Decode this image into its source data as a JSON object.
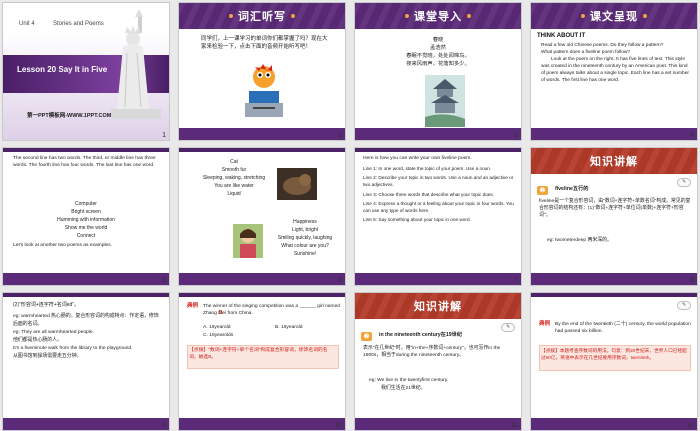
{
  "slides": [
    {
      "num": "1",
      "unit": "Unit 4",
      "unit_title": "Stories and Poems",
      "lesson": "Lesson 20  Say It in Five",
      "site": "第一PPT模板网-WWW.1PPT.COM"
    },
    {
      "num": "2",
      "title": "词汇听写",
      "body": "同学们，上一课学习的单词你们都掌握了吗？现在大家来检验一下，点击下面的音频开始听写吧！"
    },
    {
      "num": "3",
      "title": "课堂导入",
      "poem": [
        "春晓",
        "孟浩然",
        "春眠不觉晓，处处闻啼鸟。",
        "夜来风雨声，花落知多少。"
      ]
    },
    {
      "num": "4",
      "title": "课文呈现",
      "heading": "THINK ABOUT IT",
      "lines": [
        "Read a few old Chinese poems. Do they follow a pattern?",
        "What pattern does a fiveline poem follow?",
        "Look at the poem on the right. It has five lines of text. This style was created in the nineteenth century by an American poet. This kind of poem always talks about a single topic. Each line has a set number of words. The first line has one word."
      ]
    },
    {
      "num": "5",
      "lines": [
        "The second line has two words. The third, or middle line has three words. The fourth line has four words. The last line has one word."
      ],
      "poem": [
        "Computer",
        "Bright screen",
        "Humming with information",
        "Show me the world",
        "Connect"
      ],
      "ending": "Let's look at another two poems as examples."
    },
    {
      "num": "6",
      "poem1": [
        "Cat",
        "Smooth fur",
        "Sleeping, waking, stretching",
        "You are like water",
        "Liquid"
      ],
      "poem2": [
        "Happiness",
        "Light, bright",
        "Smiling quickly, laughing",
        "What colour are you?",
        "Sunshine!"
      ]
    },
    {
      "num": "7",
      "intro": "Here is how you can write your own fiveline poem.",
      "steps": [
        "Line 1:  In one word, state the topic of your poem. Use a noun.",
        "Line 2:  Describe your topic in two words. Use a noun and an adjective or two adjectives.",
        "Line 3:  Choose three words that describe what your topic does.",
        "Line 4:  Express a thought or a feeling about your topic in four words. You can use any type of words here.",
        "Line 5:  Say something about your topic in one word."
      ]
    },
    {
      "num": "8",
      "title": "知识讲解",
      "point": "fiveline五行的",
      "body": "fiveline是一个复合形容词，由\"数词+连字符+单数名词\"构成。常见的复合形容词的结构还有：(1)\"数词+连字符+单位词(单数)+连字符+形容词\"；",
      "eg": "eg: twometerdeep  两米深的。"
    },
    {
      "num": "9",
      "line0": "(2)\"形容词+连字符+名词ed\"。",
      "lines": [
        "eg: warmhearted 热心肠的。复合形容词的构成特点：作定语，修饰后面的名词。",
        "eg: They are all warmhearted people.",
        "他们都是热心肠的人。",
        "It's a fiveminute walk from the library to the playground.",
        "从图书馆到操场需要走五分钟。"
      ]
    },
    {
      "num": "10",
      "label": "典例",
      "q": "The winner of the singing competition was a ______ girl named Zhang Mei from China.",
      "ans": "B",
      "opts": [
        "A. 16yearold",
        "B. 16yearold",
        "C. 16yearolds"
      ],
      "tip": "【点拨】\"数词+连字符+单个名词\"构成复合形容词，修饰名词的名词，故选B。"
    },
    {
      "num": "11",
      "title": "知识讲解",
      "point": "in the nineteenth century在19世纪",
      "body": "表示\"在几世纪\"时，用\"in+the+序数词+century\"。也可写作in the 1900s，相当于during the nineteenth century。",
      "eg": "eg: We live in the twentyfirst century.",
      "eg_cn": "我们生活在21世纪。"
    },
    {
      "num": "12",
      "label": "典例",
      "q": "By the end of the twentieth (二十) century, the world population had passed six billion.",
      "tip": "【点拨】本题考查序数词的用法。句意：到20世纪末，世界人口已经超过60亿。英语中表示在几世纪要用序数词，twentieth。"
    }
  ]
}
